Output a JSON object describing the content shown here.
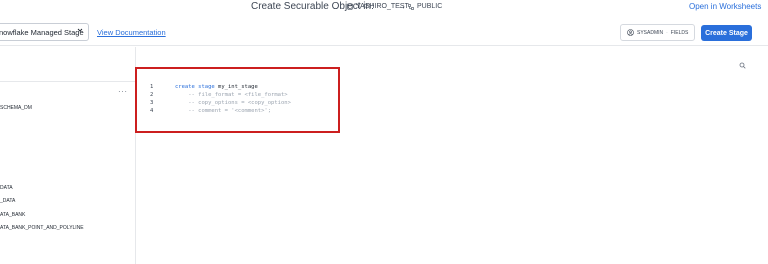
{
  "header": {
    "title": "Create Securable Object in:",
    "database": "YASHIRO_TEST",
    "arrow": "→",
    "schema": "PUBLIC",
    "open_worksheets": "Open in Worksheets"
  },
  "toolbar": {
    "stage_type": "nowflake Managed Stage",
    "view_documentation": "View Documentation",
    "role": "SYSADMIN",
    "role_separator": "·",
    "warehouse": "FIELDS",
    "create_button": "Create Stage"
  },
  "left_panel": {
    "more": "···",
    "items": [
      "SCHEMA_DM",
      "DATA",
      "_DATA",
      "ATA_BANK",
      "ATA_BANK_POINT_AND_POLYLINE"
    ]
  },
  "editor": {
    "line_numbers": [
      "1",
      "2",
      "3",
      "4"
    ],
    "line1": {
      "kw": "create stage",
      "rest": " my_int_stage"
    },
    "line2": "    -- file_format = <file_format>",
    "line3": "    -- copy_options = <copy_option>",
    "line4": "    -- comment = '<comment>';"
  },
  "colors": {
    "accent": "#2a6fdb",
    "highlight_border": "#cc1f1f"
  }
}
